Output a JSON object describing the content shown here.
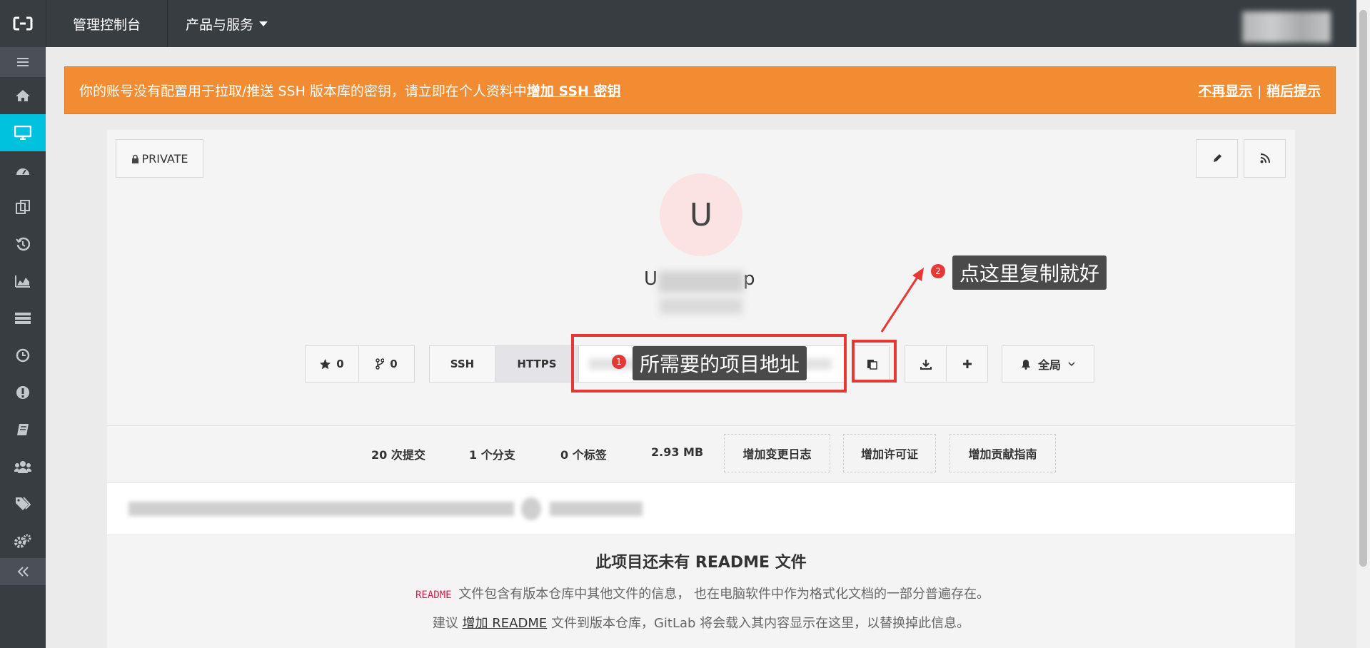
{
  "topbar": {
    "console_label": "管理控制台",
    "products_label": "产品与服务"
  },
  "alert": {
    "message": "你的账号没有配置用于拉取/推送 SSH 版本库的密钥，请立即在个人资料中",
    "add_key_link": "增加 SSH 密钥",
    "dismiss_label": "不再显示",
    "separator": "|",
    "remind_later_label": "稍后提示"
  },
  "project": {
    "visibility_label": "PRIVATE",
    "avatar_letter": "U",
    "name_start": "U",
    "name_end": "p",
    "star_count": "0",
    "fork_count": "0",
    "clone_tabs": [
      "SSH",
      "HTTPS"
    ],
    "notification_label": "全局"
  },
  "annotations": {
    "badge1": "1",
    "label1": "所需要的项目地址",
    "badge2": "2",
    "label2": "点这里复制就好"
  },
  "stats": {
    "commits": "20 次提交",
    "branches": "1 个分支",
    "tags": "0 个标签",
    "size": "2.93 MB",
    "add_changelog": "增加变更日志",
    "add_license": "增加许可证",
    "add_contributing": "增加贡献指南"
  },
  "readme": {
    "title": "此项目还未有 README 文件",
    "code_label": "README",
    "line1_text": "文件包含有版本仓库中其他文件的信息， 也在电脑软件中作为格式化文档的一部分普遍存在。",
    "line2_prefix": "建议",
    "line2_link": "增加 README",
    "line2_suffix": "文件到版本仓库，GitLab 将会载入其内容显示在这里，以替换掉此信息。"
  },
  "icons": [
    "aliyun-logo-icon",
    "menu-icon",
    "home-icon",
    "monitor-icon",
    "dashboard-icon",
    "copy-pages-icon",
    "history-icon",
    "area-chart-icon",
    "list-icon",
    "clock-icon",
    "exclamation-icon",
    "book-icon",
    "users-icon",
    "tags-icon",
    "cogs-icon",
    "double-chevron-left-icon",
    "lock-icon",
    "pencil-icon",
    "rss-icon",
    "star-icon",
    "fork-icon",
    "clipboard-icon",
    "download-icon",
    "plus-icon",
    "bell-icon",
    "chevron-down-icon"
  ],
  "colors": {
    "topbar": "#373d41",
    "active_accent": "#00c1de",
    "alert": "#f28c33",
    "annotation_red": "#e53935"
  }
}
